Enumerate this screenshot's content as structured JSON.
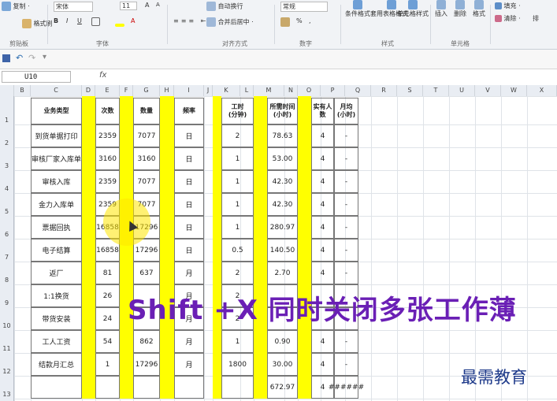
{
  "ribbon": {
    "clipboard": {
      "paste": "复制 ·",
      "format_painter": "格式刷",
      "group": "剪贴板"
    },
    "font": {
      "name": "宋体",
      "size": "11",
      "grow": "A",
      "shrink": "A",
      "bold": "B",
      "italic": "I",
      "underline": "U",
      "group": "字体"
    },
    "alignment": {
      "wrap": "自动换行",
      "merge": "合并后居中 ·",
      "group": "对齐方式"
    },
    "number": {
      "format": "常规",
      "percent": "%",
      "comma": ",",
      "group": "数字"
    },
    "styles": {
      "conditional": "条件格式",
      "table": "套用表格格式 ·",
      "cell": "单元格样式",
      "group": "样式"
    },
    "cells": {
      "insert": "插入",
      "delete": "删除",
      "format": "格式",
      "group": "单元格"
    },
    "editing": {
      "fill": "填充 ·",
      "clear": "清除 ·",
      "sort": "排"
    }
  },
  "formula_bar": {
    "name_box": "U10",
    "fx": "fx",
    "value": ""
  },
  "columns": [
    "B",
    "C",
    "D",
    "E",
    "F",
    "G",
    "H",
    "I",
    "J",
    "K",
    "L",
    "M",
    "N",
    "O",
    "P",
    "Q",
    "R",
    "S",
    "T",
    "U",
    "V",
    "W",
    "X"
  ],
  "rows": [
    "1",
    "2",
    "3",
    "4",
    "5",
    "6",
    "7",
    "8",
    "9",
    "10",
    "11",
    "12",
    "13"
  ],
  "table": {
    "headers": [
      "业务类型",
      "次数",
      "数量",
      "频率",
      "工时\n(分钟)",
      "所需时间\n(小时)",
      "实有人\n数",
      "月均\n(小时)"
    ],
    "data": [
      [
        "到货单据打印",
        "2359",
        "7077",
        "日",
        "2",
        "78.63",
        "4",
        "-"
      ],
      [
        "审核厂家入库单",
        "3160",
        "3160",
        "日",
        "1",
        "53.00",
        "4",
        "-"
      ],
      [
        "审核入库",
        "2359",
        "7077",
        "日",
        "1",
        "42.30",
        "4",
        "-"
      ],
      [
        "金力入库单",
        "2359",
        "7077",
        "日",
        "1",
        "42.30",
        "4",
        "-"
      ],
      [
        "票据回执",
        "16858",
        "17296",
        "日",
        "1",
        "280.97",
        "4",
        "-"
      ],
      [
        "电子结算",
        "16858",
        "17296",
        "日",
        "0.5",
        "140.50",
        "4",
        "-"
      ],
      [
        "返厂",
        "81",
        "637",
        "月",
        "2",
        "2.70",
        "4",
        "-"
      ],
      [
        "1:1换货",
        "26",
        "",
        "月",
        "2",
        "",
        "",
        ""
      ],
      [
        "带货安装",
        "24",
        "",
        "月",
        "2",
        "",
        "",
        ""
      ],
      [
        "工人工资",
        "54",
        "862",
        "月",
        "1",
        "0.90",
        "4",
        "-"
      ],
      [
        "结款月汇总",
        "1",
        "17296",
        "月",
        "1800",
        "30.00",
        "4",
        "-"
      ],
      [
        "",
        "",
        "",
        "",
        "",
        "672.97",
        "4",
        "######"
      ]
    ]
  },
  "overlay_text": "Shift +X  同时关闭多张工作薄",
  "watermark": "最需教育",
  "colors": {
    "highlight": "#ffff00",
    "overlay": "#6a1fb5",
    "watermark": "#1e3a8a"
  }
}
